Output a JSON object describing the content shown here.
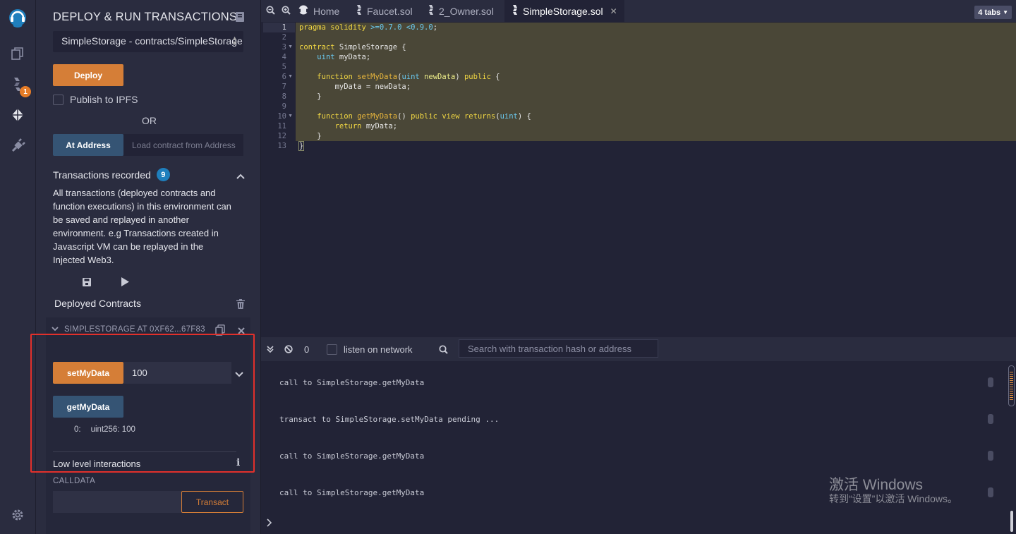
{
  "rail": {
    "settings_label": ""
  },
  "plugin_badge": "1",
  "panel": {
    "title": "DEPLOY & RUN TRANSACTIONS",
    "contract_select": "SimpleStorage - contracts/SimpleStorage.sol",
    "deploy_label": "Deploy",
    "publish_label": "Publish to IPFS",
    "or_label": "OR",
    "at_address_label": "At Address",
    "at_address_placeholder": "Load contract from Address",
    "tx_recorded_label": "Transactions recorded",
    "tx_recorded_count": "9",
    "tx_description": "All transactions (deployed contracts and function executions) in this environment can be saved and replayed in another environment. e.g Transactions created in Javascript VM can be replayed in the Injected Web3.",
    "deployed_contracts_label": "Deployed Contracts",
    "instance_title": "SIMPLESTORAGE AT 0XF62...67F83",
    "setMyData_label": "setMyData",
    "setMyData_value": "100",
    "getMyData_label": "getMyData",
    "output_index": "0:",
    "output_value": "uint256: 100",
    "low_level_label": "Low level interactions",
    "calldata_label": "CALLDATA",
    "transact_label": "Transact"
  },
  "editor": {
    "tabs": [
      {
        "label": "Home"
      },
      {
        "label": "Faucet.sol"
      },
      {
        "label": "2_Owner.sol"
      },
      {
        "label": "SimpleStorage.sol"
      }
    ],
    "tab_count": "4 tabs",
    "line_numbers": [
      "1",
      "2",
      "3",
      "4",
      "5",
      "6",
      "7",
      "8",
      "9",
      "10",
      "11",
      "12",
      "13"
    ]
  },
  "terminal": {
    "pending_count": "0",
    "listen_label": "listen on network",
    "search_placeholder": "Search with transaction hash or address",
    "logs": [
      "call to SimpleStorage.getMyData",
      "transact to SimpleStorage.setMyData pending ...",
      "call to SimpleStorage.getMyData",
      "call to SimpleStorage.getMyData"
    ]
  },
  "watermark": {
    "line1": "激活 Windows",
    "line2": "转到“设置”以激活 Windows。"
  },
  "colors": {
    "accent_orange": "#d57e37",
    "button_blue": "#355474",
    "highlight_red": "#e2302b",
    "code_highlight": "#4a4737"
  }
}
